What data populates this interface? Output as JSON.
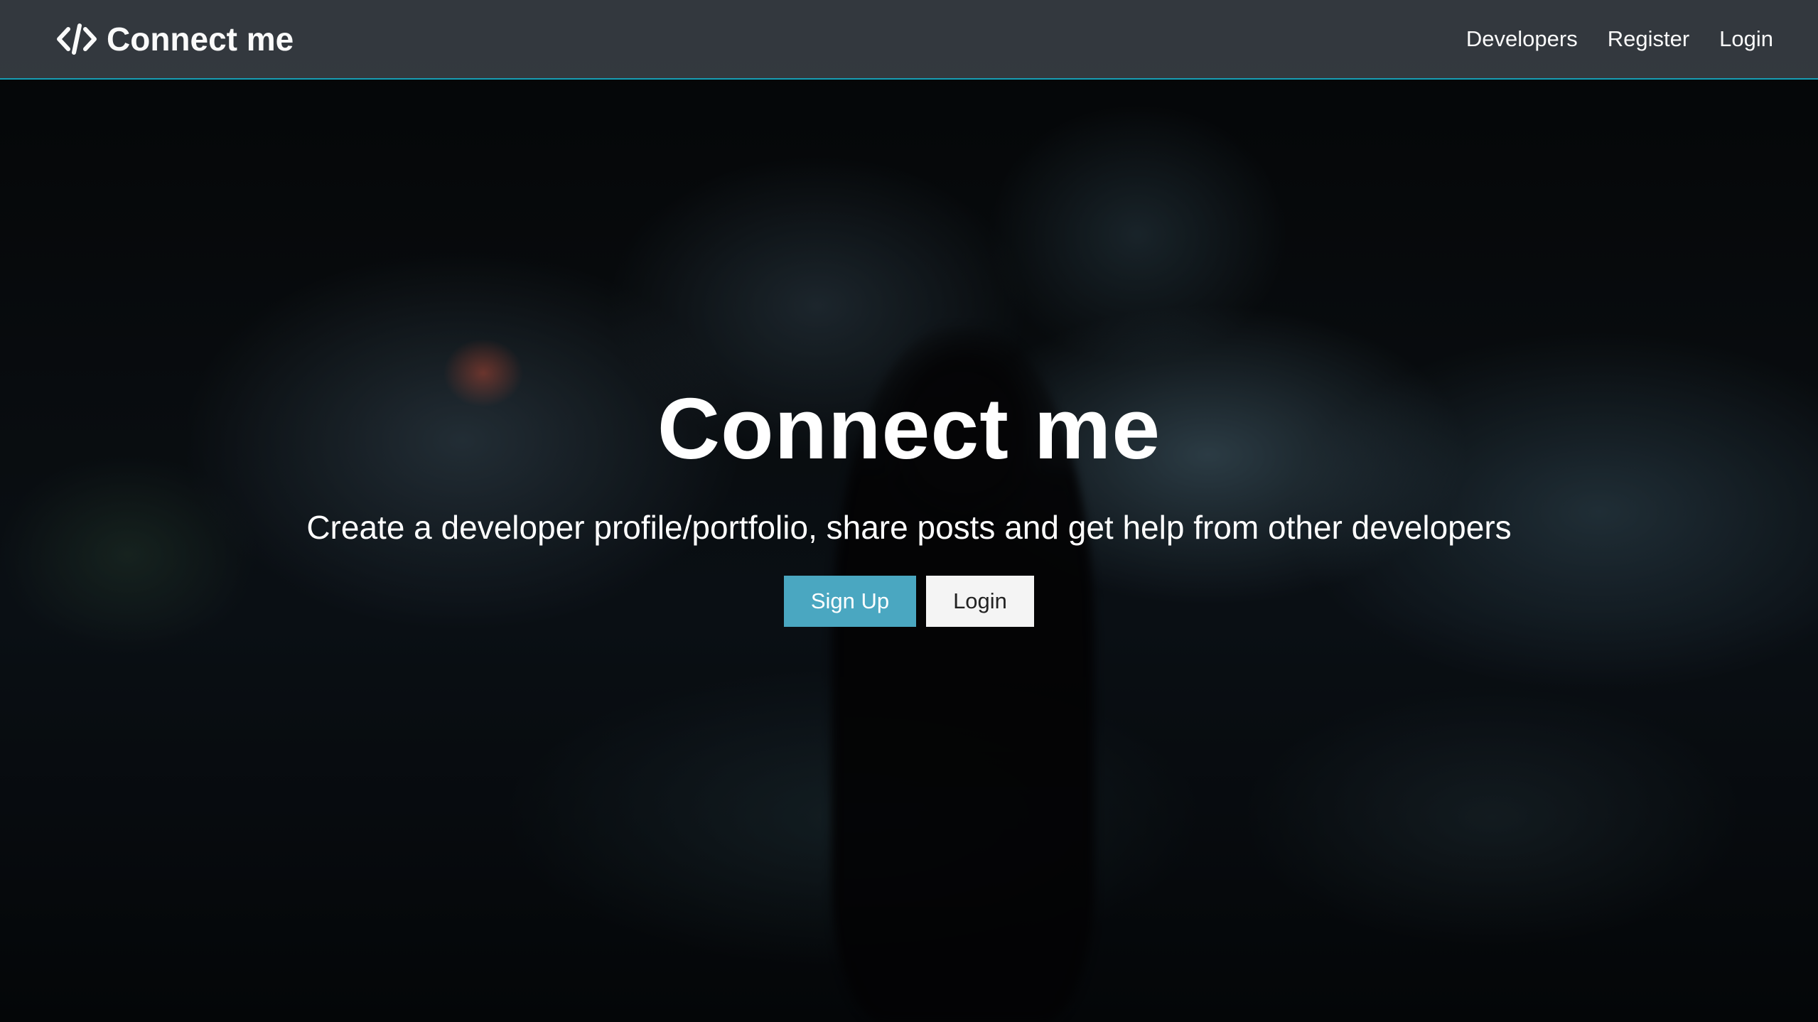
{
  "navbar": {
    "brand_icon": "code-icon",
    "brand_label": "Connect me",
    "links": [
      {
        "label": "Developers"
      },
      {
        "label": "Register"
      },
      {
        "label": "Login"
      }
    ]
  },
  "hero": {
    "title": "Connect me",
    "lead": "Create a developer profile/portfolio, share posts and get help from other developers",
    "signup_label": "Sign Up",
    "login_label": "Login"
  },
  "colors": {
    "navbar_bg": "#343a40",
    "accent": "#17a2b8",
    "signup_button": "#4aa7c1",
    "login_button": "#f4f4f4"
  }
}
